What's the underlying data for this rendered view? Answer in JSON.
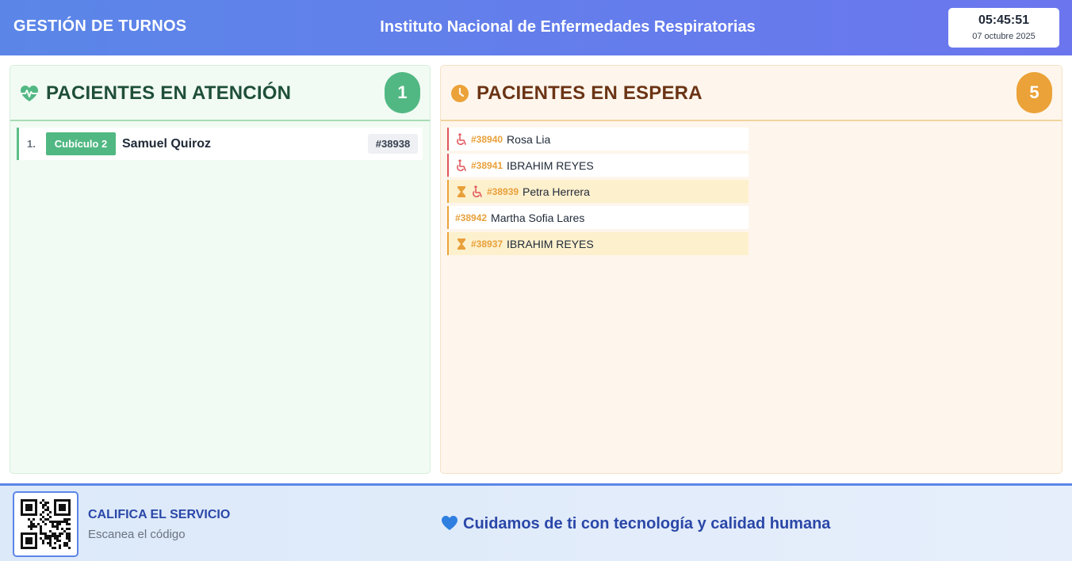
{
  "header": {
    "app_title": "GESTIÓN DE TURNOS",
    "institution": "Instituto Nacional de Enfermedades Respiratorias",
    "clock": {
      "time": "05:45:51",
      "date": "07 octubre 2025"
    }
  },
  "attention": {
    "title": "PACIENTES EN ATENCIÓN",
    "icon": "heart-pulse-icon",
    "count": "1",
    "rows": [
      {
        "num": "1.",
        "cubicle": "Cubículo 2",
        "name": "Samuel Quiroz",
        "ticket": "#38938"
      }
    ]
  },
  "waiting": {
    "title": "PACIENTES EN ESPERA",
    "icon": "clock-icon",
    "count": "5",
    "rows": [
      {
        "ticket": "#38940",
        "name": "Rosa Lia",
        "icons": [
          "wheelchair-icon"
        ],
        "highlight": false
      },
      {
        "ticket": "#38941",
        "name": "IBRAHIM REYES",
        "icons": [
          "wheelchair-icon"
        ],
        "highlight": false
      },
      {
        "ticket": "#38939",
        "name": "Petra Herrera",
        "icons": [
          "hourglass-icon",
          "wheelchair-icon"
        ],
        "highlight": true
      },
      {
        "ticket": "#38942",
        "name": "Martha Sofia Lares",
        "icons": [],
        "highlight": false
      },
      {
        "ticket": "#38937",
        "name": "IBRAHIM REYES",
        "icons": [
          "hourglass-icon"
        ],
        "highlight": true
      }
    ]
  },
  "footer": {
    "rate_title": "CALIFICA EL SERVICIO",
    "rate_subtitle": "Escanea el código",
    "slogan": "Cuidamos de ti con tecnología y calidad humana",
    "qr_icon": "qr-code-icon",
    "heart_icon": "blue-heart-icon"
  },
  "colors": {
    "header_gradient_start": "#5b86e8",
    "header_gradient_end": "#6b76ee",
    "attention_accent": "#52b883",
    "waiting_accent": "#eba238",
    "wheelchair_red": "#e0555a",
    "footer_text": "#2a47a8"
  }
}
